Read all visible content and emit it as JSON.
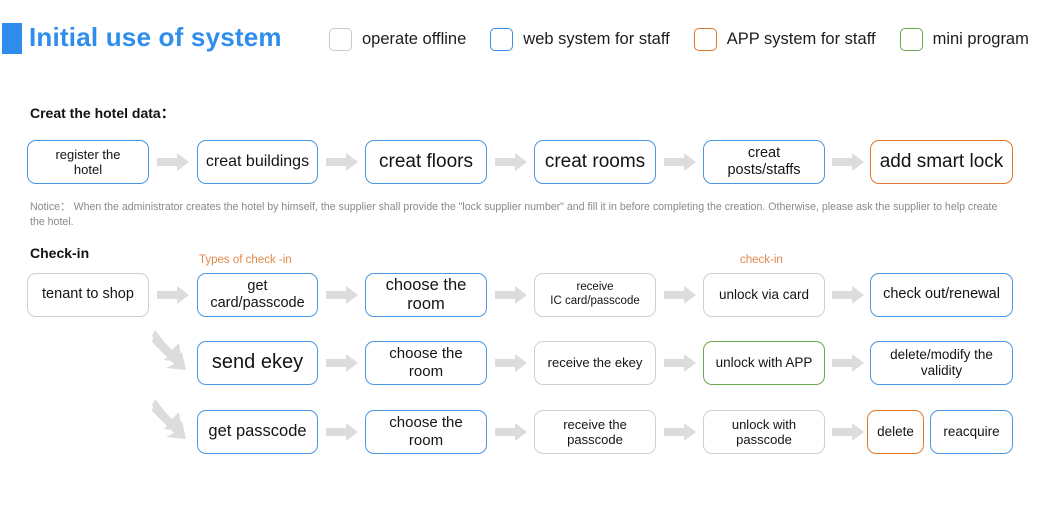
{
  "header": {
    "title": "Initial use of system",
    "legend": [
      {
        "label": "operate offline",
        "color": "#c9c9c9",
        "style": "gray"
      },
      {
        "label": "web system for staff",
        "color": "#3a90e8",
        "style": "blue"
      },
      {
        "label": "APP system for staff",
        "color": "#e2762c",
        "style": "orange"
      },
      {
        "label": "mini program",
        "color": "#6aa84f",
        "style": "green"
      }
    ]
  },
  "sections": {
    "create_hotel": {
      "heading": "Creat the hotel data：",
      "notice": "Notice： When the administrator creates the hotel by himself, the supplier shall provide the \"lock supplier number\" and fill it in before completing the creation. Otherwise, please ask the supplier to help create the hotel.",
      "steps": [
        {
          "label": "register the\nhotel",
          "style": "blue"
        },
        {
          "label": "creat buildings",
          "style": "blue"
        },
        {
          "label": "creat floors",
          "style": "blue"
        },
        {
          "label": "creat rooms",
          "style": "blue"
        },
        {
          "label": "creat\nposts/staffs",
          "style": "blue"
        },
        {
          "label": "add smart lock",
          "style": "orange"
        }
      ]
    },
    "checkin": {
      "heading": "Check-in",
      "captions": [
        {
          "text": "Types of check -in"
        },
        {
          "text": "check-in"
        }
      ],
      "entry": {
        "label": "tenant to shop",
        "style": "gray"
      },
      "rows": [
        {
          "steps": [
            {
              "label": "get\ncard/passcode",
              "style": "blue"
            },
            {
              "label": "choose the\nroom",
              "style": "blue"
            },
            {
              "label": "receive\nIC card/passcode",
              "style": "gray"
            },
            {
              "label": "unlock via card",
              "style": "gray"
            },
            {
              "label": "check out/renewal",
              "style": "blue"
            }
          ]
        },
        {
          "steps": [
            {
              "label": "send ekey",
              "style": "blue"
            },
            {
              "label": "choose the\nroom",
              "style": "blue"
            },
            {
              "label": "receive the ekey",
              "style": "gray"
            },
            {
              "label": "unlock with APP",
              "style": "green"
            },
            {
              "label": "delete/modify the\nvalidity",
              "style": "blue"
            }
          ]
        },
        {
          "steps": [
            {
              "label": "get passcode",
              "style": "blue"
            },
            {
              "label": "choose the\nroom",
              "style": "blue"
            },
            {
              "label": "receive the\npasscode",
              "style": "gray"
            },
            {
              "label": "unlock with\npasscode",
              "style": "gray"
            },
            {
              "label": "delete",
              "style": "orange"
            },
            {
              "label": "reacquire",
              "style": "blue"
            }
          ]
        }
      ]
    }
  }
}
